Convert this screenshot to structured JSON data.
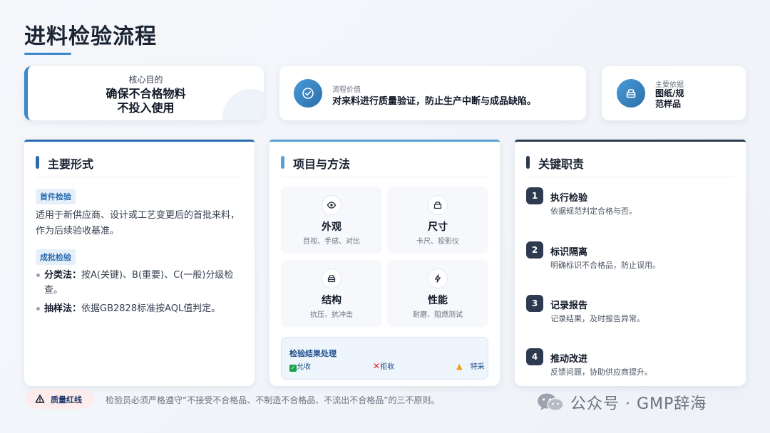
{
  "header": {
    "title": "进料检验流程"
  },
  "purpose": {
    "label": "核心目的",
    "line1": "确保不合格物料",
    "line2": "不投入使用"
  },
  "value": {
    "label": "流程价值",
    "text": "对来料进行质量验证，防止生产中断与成品缺陷。",
    "icon": "check-circle-icon"
  },
  "basis": {
    "label": "主要依据",
    "text": "图纸/规范样品",
    "icon": "archive-icon"
  },
  "panel_forms": {
    "heading": "主要形式",
    "first_tag": "首件检验",
    "first_text": "适用于新供应商、设计或工艺变更后的首批来料，作为后续验收基准。",
    "batch_tag": "成批检验",
    "bullets": [
      {
        "term": "分类法：",
        "text": "按A(关键)、B(重要)、C(一般)分级检查。"
      },
      {
        "term": "抽样法：",
        "text": "依据GB2828标准按AQL值判定。"
      }
    ]
  },
  "panel_methods": {
    "heading": "项目与方法",
    "items": [
      {
        "name": "外观",
        "desc": "目视、手感、对比",
        "icon": "eye-icon"
      },
      {
        "name": "尺寸",
        "desc": "卡尺、投影仪",
        "icon": "box-icon"
      },
      {
        "name": "结构",
        "desc": "抗压、抗冲击",
        "icon": "box-icon"
      },
      {
        "name": "性能",
        "desc": "耐磨、阻燃测试",
        "icon": "bolt-icon"
      }
    ],
    "result": {
      "title": "检验结果处理",
      "accept": "允收",
      "reject": "拒收",
      "special": "特采"
    }
  },
  "panel_duties": {
    "heading": "关键职责",
    "steps": [
      {
        "num": "1",
        "title": "执行检验",
        "desc": "依据规范判定合格与否。"
      },
      {
        "num": "2",
        "title": "标识隔离",
        "desc": "明确标识不合格品，防止误用。"
      },
      {
        "num": "3",
        "title": "记录报告",
        "desc": "记录结果，及时报告异常。"
      },
      {
        "num": "4",
        "title": "推动改进",
        "desc": "反馈问题，协助供应商提升。"
      }
    ]
  },
  "footer": {
    "badge": "质量红线",
    "note": "检验员必须严格遵守“不接受不合格品、不制造不合格品、不流出不合格品”的三不原则。",
    "watermark": "公众号 · GMP辞海"
  },
  "colors": {
    "accent": "#3b87c8",
    "dark": "#2d3a4f",
    "accept": "#16a34a",
    "reject": "#dc2626",
    "warn": "#f59e0b"
  }
}
